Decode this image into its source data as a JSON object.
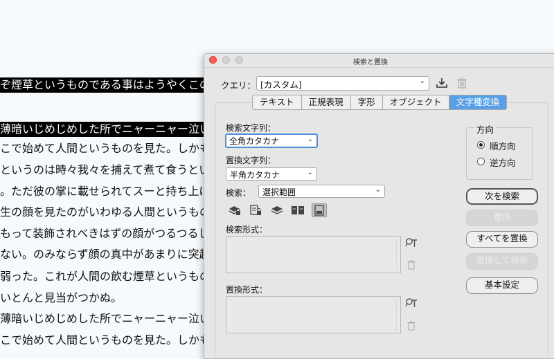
{
  "document": {
    "lines": [
      {
        "text": "ぞ煙草というものである事はようやくこの頃",
        "selected": true
      },
      {
        "text": "",
        "selected": false
      },
      {
        "text": "薄暗いじめじめした所でニャーニャー泣いていた",
        "selected": true
      },
      {
        "text": "こで始めて人間というものを見た。しかもあと",
        "selected": false
      },
      {
        "text": "というのは時々我々を捕えて煮て食うという話で",
        "selected": false
      },
      {
        "text": "。ただ彼の掌に載せられてスーと持ち上げら",
        "selected": false
      },
      {
        "text": "生の顔を見たのがいわゆる人間というものの",
        "selected": false
      },
      {
        "text": "もって装飾されべきはずの顔がつるつるして",
        "selected": false
      },
      {
        "text": "ない。のみならず顔の真中があまりに突起して",
        "selected": false
      },
      {
        "text": "弱った。これが人間の飲む煙草というものであ",
        "selected": false
      },
      {
        "text": "いとんと見当がつかぬ。",
        "selected": false
      },
      {
        "text": "薄暗いじめじめした所でニャーニャー泣いていた",
        "selected": false
      },
      {
        "text": "こで始めて人間というものを見た。しかもあと",
        "selected": false
      }
    ]
  },
  "dialog": {
    "title": "検索と置換",
    "query": {
      "label": "クエリ：",
      "value": "[カスタム]"
    },
    "query_icons": [
      "save-query-icon",
      "trash-icon"
    ],
    "tabs": [
      {
        "label": "テキスト",
        "active": false
      },
      {
        "label": "正規表現",
        "active": false
      },
      {
        "label": "字形",
        "active": false
      },
      {
        "label": "オブジェクト",
        "active": false
      },
      {
        "label": "文字種変換",
        "active": true
      }
    ],
    "find": {
      "label": "検索文字列：",
      "value": "全角カタカナ"
    },
    "change": {
      "label": "置換文字列：",
      "value": "半角カタカナ"
    },
    "search": {
      "label": "検索：",
      "value": "選択範囲"
    },
    "option_icons": [
      "include-locked-layers-icon",
      "include-locked-stories-icon",
      "include-hidden-layers-icon",
      "include-master-pages-icon",
      "include-footnotes-icon"
    ],
    "find_format": {
      "label": "検索形式："
    },
    "change_format": {
      "label": "置換形式："
    },
    "direction": {
      "label": "方向",
      "options": [
        {
          "label": "順方向",
          "selected": true
        },
        {
          "label": "逆方向",
          "selected": false
        }
      ]
    },
    "buttons": {
      "find_next": "次を検索",
      "change": "置換",
      "change_all": "すべてを置換",
      "change_find": "置換して検索",
      "done": "基本設定"
    },
    "colors": {
      "accent": "#58a0e6",
      "close": "#fc5f57",
      "panel": "#e6e6e6"
    }
  }
}
